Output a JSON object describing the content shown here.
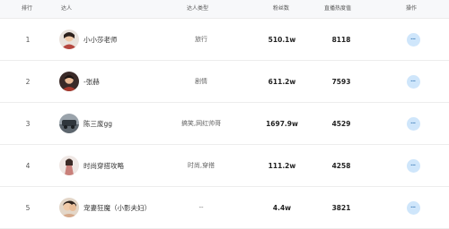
{
  "header": {
    "rank": "排行",
    "influencer": "达人",
    "type": "达人类型",
    "fans": "粉丝数",
    "heat": "直播热度值",
    "action": "操作"
  },
  "rows": [
    {
      "rank": "1",
      "name": "小小莎老师",
      "type": "旅行",
      "fans": "510.1w",
      "heat": "8118",
      "more": "···",
      "avatar_icon": "avatar-photo",
      "avatar_color": "#b5473f"
    },
    {
      "rank": "2",
      "name": "-张赫",
      "type": "剧情",
      "fans": "611.2w",
      "heat": "7593",
      "more": "···",
      "avatar_icon": "avatar-photo",
      "avatar_color": "#a83a2f"
    },
    {
      "rank": "3",
      "name": "陈三废gg",
      "type": "搞笑,网红帅哥",
      "fans": "1697.9w",
      "heat": "4529",
      "more": "···",
      "avatar_icon": "avatar-photo",
      "avatar_color": "#6e7a86"
    },
    {
      "rank": "4",
      "name": "时尚穿搭攻略",
      "type": "时尚,穿搭",
      "fans": "111.2w",
      "heat": "4258",
      "more": "···",
      "avatar_icon": "avatar-photo",
      "avatar_color": "#c9807a"
    },
    {
      "rank": "5",
      "name": "宠妻狂魔（小影夫妇）",
      "type": "--",
      "fans": "4.4w",
      "heat": "3821",
      "more": "···",
      "avatar_icon": "avatar-photo",
      "avatar_color": "#d6a98a"
    }
  ],
  "colors": {
    "header_bg": "#f7f8fa",
    "action_button": "#cfe6fb",
    "action_dots": "#2a6fb0"
  }
}
